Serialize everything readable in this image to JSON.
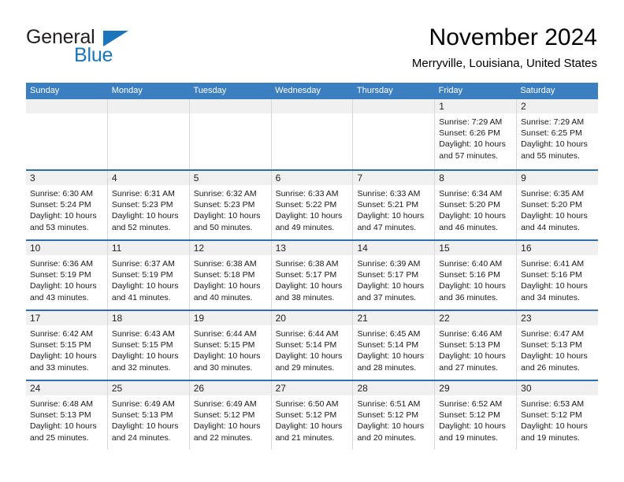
{
  "brand": {
    "line1": "General",
    "line2": "Blue",
    "triangle_color": "#1b75bb"
  },
  "header": {
    "title": "November 2024",
    "location": "Merryville, Louisiana, United States"
  },
  "theme": {
    "header_blue": "#3c7fc1",
    "row_divider_blue": "#2f6fb0",
    "date_band_gray": "#f0f0f0",
    "text_black": "#000000"
  },
  "weekdays": [
    "Sunday",
    "Monday",
    "Tuesday",
    "Wednesday",
    "Thursday",
    "Friday",
    "Saturday"
  ],
  "labels": {
    "sunrise_prefix": "Sunrise: ",
    "sunset_prefix": "Sunset: ",
    "daylight_prefix": "Daylight: "
  },
  "weeks": [
    [
      {
        "empty": true
      },
      {
        "empty": true
      },
      {
        "empty": true
      },
      {
        "empty": true
      },
      {
        "empty": true
      },
      {
        "empty": false,
        "date": "1",
        "sunrise": "Sunrise: 7:29 AM",
        "sunset": "Sunset: 6:26 PM",
        "daylight_a": "Daylight: 10 hours",
        "daylight_b": "and 57 minutes."
      },
      {
        "empty": false,
        "date": "2",
        "sunrise": "Sunrise: 7:29 AM",
        "sunset": "Sunset: 6:25 PM",
        "daylight_a": "Daylight: 10 hours",
        "daylight_b": "and 55 minutes."
      }
    ],
    [
      {
        "empty": false,
        "date": "3",
        "sunrise": "Sunrise: 6:30 AM",
        "sunset": "Sunset: 5:24 PM",
        "daylight_a": "Daylight: 10 hours",
        "daylight_b": "and 53 minutes."
      },
      {
        "empty": false,
        "date": "4",
        "sunrise": "Sunrise: 6:31 AM",
        "sunset": "Sunset: 5:23 PM",
        "daylight_a": "Daylight: 10 hours",
        "daylight_b": "and 52 minutes."
      },
      {
        "empty": false,
        "date": "5",
        "sunrise": "Sunrise: 6:32 AM",
        "sunset": "Sunset: 5:23 PM",
        "daylight_a": "Daylight: 10 hours",
        "daylight_b": "and 50 minutes."
      },
      {
        "empty": false,
        "date": "6",
        "sunrise": "Sunrise: 6:33 AM",
        "sunset": "Sunset: 5:22 PM",
        "daylight_a": "Daylight: 10 hours",
        "daylight_b": "and 49 minutes."
      },
      {
        "empty": false,
        "date": "7",
        "sunrise": "Sunrise: 6:33 AM",
        "sunset": "Sunset: 5:21 PM",
        "daylight_a": "Daylight: 10 hours",
        "daylight_b": "and 47 minutes."
      },
      {
        "empty": false,
        "date": "8",
        "sunrise": "Sunrise: 6:34 AM",
        "sunset": "Sunset: 5:20 PM",
        "daylight_a": "Daylight: 10 hours",
        "daylight_b": "and 46 minutes."
      },
      {
        "empty": false,
        "date": "9",
        "sunrise": "Sunrise: 6:35 AM",
        "sunset": "Sunset: 5:20 PM",
        "daylight_a": "Daylight: 10 hours",
        "daylight_b": "and 44 minutes."
      }
    ],
    [
      {
        "empty": false,
        "date": "10",
        "sunrise": "Sunrise: 6:36 AM",
        "sunset": "Sunset: 5:19 PM",
        "daylight_a": "Daylight: 10 hours",
        "daylight_b": "and 43 minutes."
      },
      {
        "empty": false,
        "date": "11",
        "sunrise": "Sunrise: 6:37 AM",
        "sunset": "Sunset: 5:19 PM",
        "daylight_a": "Daylight: 10 hours",
        "daylight_b": "and 41 minutes."
      },
      {
        "empty": false,
        "date": "12",
        "sunrise": "Sunrise: 6:38 AM",
        "sunset": "Sunset: 5:18 PM",
        "daylight_a": "Daylight: 10 hours",
        "daylight_b": "and 40 minutes."
      },
      {
        "empty": false,
        "date": "13",
        "sunrise": "Sunrise: 6:38 AM",
        "sunset": "Sunset: 5:17 PM",
        "daylight_a": "Daylight: 10 hours",
        "daylight_b": "and 38 minutes."
      },
      {
        "empty": false,
        "date": "14",
        "sunrise": "Sunrise: 6:39 AM",
        "sunset": "Sunset: 5:17 PM",
        "daylight_a": "Daylight: 10 hours",
        "daylight_b": "and 37 minutes."
      },
      {
        "empty": false,
        "date": "15",
        "sunrise": "Sunrise: 6:40 AM",
        "sunset": "Sunset: 5:16 PM",
        "daylight_a": "Daylight: 10 hours",
        "daylight_b": "and 36 minutes."
      },
      {
        "empty": false,
        "date": "16",
        "sunrise": "Sunrise: 6:41 AM",
        "sunset": "Sunset: 5:16 PM",
        "daylight_a": "Daylight: 10 hours",
        "daylight_b": "and 34 minutes."
      }
    ],
    [
      {
        "empty": false,
        "date": "17",
        "sunrise": "Sunrise: 6:42 AM",
        "sunset": "Sunset: 5:15 PM",
        "daylight_a": "Daylight: 10 hours",
        "daylight_b": "and 33 minutes."
      },
      {
        "empty": false,
        "date": "18",
        "sunrise": "Sunrise: 6:43 AM",
        "sunset": "Sunset: 5:15 PM",
        "daylight_a": "Daylight: 10 hours",
        "daylight_b": "and 32 minutes."
      },
      {
        "empty": false,
        "date": "19",
        "sunrise": "Sunrise: 6:44 AM",
        "sunset": "Sunset: 5:15 PM",
        "daylight_a": "Daylight: 10 hours",
        "daylight_b": "and 30 minutes."
      },
      {
        "empty": false,
        "date": "20",
        "sunrise": "Sunrise: 6:44 AM",
        "sunset": "Sunset: 5:14 PM",
        "daylight_a": "Daylight: 10 hours",
        "daylight_b": "and 29 minutes."
      },
      {
        "empty": false,
        "date": "21",
        "sunrise": "Sunrise: 6:45 AM",
        "sunset": "Sunset: 5:14 PM",
        "daylight_a": "Daylight: 10 hours",
        "daylight_b": "and 28 minutes."
      },
      {
        "empty": false,
        "date": "22",
        "sunrise": "Sunrise: 6:46 AM",
        "sunset": "Sunset: 5:13 PM",
        "daylight_a": "Daylight: 10 hours",
        "daylight_b": "and 27 minutes."
      },
      {
        "empty": false,
        "date": "23",
        "sunrise": "Sunrise: 6:47 AM",
        "sunset": "Sunset: 5:13 PM",
        "daylight_a": "Daylight: 10 hours",
        "daylight_b": "and 26 minutes."
      }
    ],
    [
      {
        "empty": false,
        "date": "24",
        "sunrise": "Sunrise: 6:48 AM",
        "sunset": "Sunset: 5:13 PM",
        "daylight_a": "Daylight: 10 hours",
        "daylight_b": "and 25 minutes."
      },
      {
        "empty": false,
        "date": "25",
        "sunrise": "Sunrise: 6:49 AM",
        "sunset": "Sunset: 5:13 PM",
        "daylight_a": "Daylight: 10 hours",
        "daylight_b": "and 24 minutes."
      },
      {
        "empty": false,
        "date": "26",
        "sunrise": "Sunrise: 6:49 AM",
        "sunset": "Sunset: 5:12 PM",
        "daylight_a": "Daylight: 10 hours",
        "daylight_b": "and 22 minutes."
      },
      {
        "empty": false,
        "date": "27",
        "sunrise": "Sunrise: 6:50 AM",
        "sunset": "Sunset: 5:12 PM",
        "daylight_a": "Daylight: 10 hours",
        "daylight_b": "and 21 minutes."
      },
      {
        "empty": false,
        "date": "28",
        "sunrise": "Sunrise: 6:51 AM",
        "sunset": "Sunset: 5:12 PM",
        "daylight_a": "Daylight: 10 hours",
        "daylight_b": "and 20 minutes."
      },
      {
        "empty": false,
        "date": "29",
        "sunrise": "Sunrise: 6:52 AM",
        "sunset": "Sunset: 5:12 PM",
        "daylight_a": "Daylight: 10 hours",
        "daylight_b": "and 19 minutes."
      },
      {
        "empty": false,
        "date": "30",
        "sunrise": "Sunrise: 6:53 AM",
        "sunset": "Sunset: 5:12 PM",
        "daylight_a": "Daylight: 10 hours",
        "daylight_b": "and 19 minutes."
      }
    ]
  ]
}
